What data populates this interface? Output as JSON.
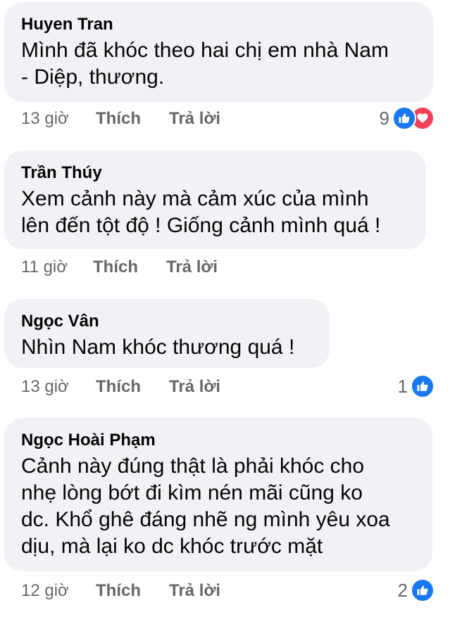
{
  "comments": [
    {
      "author": "Huyen Tran",
      "lines": [
        "Mình đã khóc theo hai chị em nhà Nam",
        "- Diệp, thương."
      ],
      "time": "13 giờ",
      "like_label": "Thích",
      "reply_label": "Trả lời",
      "reaction_count": "9",
      "reactions": [
        "like-icon",
        "love-icon"
      ]
    },
    {
      "author": "Trần Thúy",
      "lines": [
        "Xem cảnh này mà cảm xúc của mình",
        "lên đến tột độ ! Giống cảnh mình quá !"
      ],
      "time": "11 giờ",
      "like_label": "Thích",
      "reply_label": "Trả lời"
    },
    {
      "author": "Ngọc Vân",
      "lines": [
        "Nhìn Nam khóc thương quá !"
      ],
      "time": "13 giờ",
      "like_label": "Thích",
      "reply_label": "Trả lời",
      "reaction_count": "1",
      "reactions": [
        "like-icon"
      ]
    },
    {
      "author": "Ngọc Hoài Phạm",
      "lines": [
        "Cảnh này đúng thật là phải khóc cho",
        "nhẹ lòng bớt đi kìm nén mãi cũng ko",
        "dc. Khổ ghê đáng nhẽ ng mình yêu xoa",
        "dịu, mà lại ko dc khóc trước mặt"
      ],
      "time": "12 giờ",
      "like_label": "Thích",
      "reply_label": "Trả lời",
      "reaction_count": "2",
      "reactions": [
        "like-icon"
      ]
    }
  ],
  "colors": {
    "bubble": "#f0f2f5",
    "text": "#050505",
    "meta": "#65676b",
    "like": "#1877f2",
    "love": "#f33e58"
  }
}
